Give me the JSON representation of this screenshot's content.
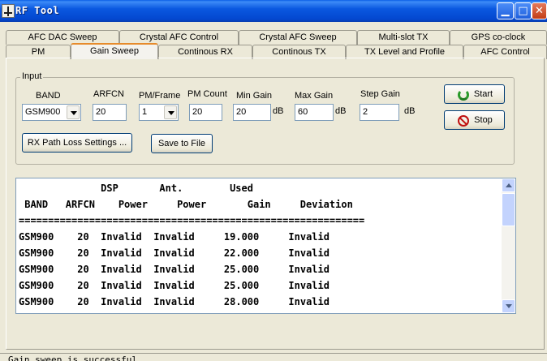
{
  "window": {
    "title": "RF Tool"
  },
  "tabs_row1": [
    {
      "label": "AFC DAC Sweep"
    },
    {
      "label": "Crystal AFC Control"
    },
    {
      "label": "Crystal AFC Sweep"
    },
    {
      "label": "Multi-slot TX"
    },
    {
      "label": "GPS co-clock"
    }
  ],
  "tabs_row2": [
    {
      "label": "PM"
    },
    {
      "label": "Gain Sweep"
    },
    {
      "label": "Continous RX"
    },
    {
      "label": "Continous TX"
    },
    {
      "label": "TX Level and Profile"
    },
    {
      "label": "AFC Control"
    }
  ],
  "active_tab": "Gain Sweep",
  "input": {
    "group_title": "Input",
    "band": {
      "label": "BAND",
      "value": "GSM900"
    },
    "arfcn": {
      "label": "ARFCN",
      "value": "20"
    },
    "pm_frame": {
      "label": "PM/Frame",
      "value": "1"
    },
    "pm_count": {
      "label": "PM Count",
      "value": "20"
    },
    "min_gain": {
      "label": "Min Gain",
      "value": "20",
      "unit": "dB"
    },
    "max_gain": {
      "label": "Max Gain",
      "value": "60",
      "unit": "dB"
    },
    "step_gain": {
      "label": "Step Gain",
      "value": "2",
      "unit": "dB"
    },
    "rx_path_button": "RX Path Loss Settings ...",
    "save_button": "Save to File",
    "start_button": "Start",
    "stop_button": "Stop"
  },
  "output": {
    "header_line1": "              DSP       Ant.        Used",
    "header_line2": " BAND   ARFCN    Power     Power       Gain     Deviation",
    "separator": "===========================================================",
    "rows": [
      {
        "band": "GSM900",
        "arfcn": "20",
        "dsp_power": "Invalid",
        "ant_power": "Invalid",
        "used_gain": "19.000",
        "deviation": "Invalid"
      },
      {
        "band": "GSM900",
        "arfcn": "20",
        "dsp_power": "Invalid",
        "ant_power": "Invalid",
        "used_gain": "22.000",
        "deviation": "Invalid"
      },
      {
        "band": "GSM900",
        "arfcn": "20",
        "dsp_power": "Invalid",
        "ant_power": "Invalid",
        "used_gain": "25.000",
        "deviation": "Invalid"
      },
      {
        "band": "GSM900",
        "arfcn": "20",
        "dsp_power": "Invalid",
        "ant_power": "Invalid",
        "used_gain": "25.000",
        "deviation": "Invalid"
      },
      {
        "band": "GSM900",
        "arfcn": "20",
        "dsp_power": "Invalid",
        "ant_power": "Invalid",
        "used_gain": "28.000",
        "deviation": "Invalid"
      }
    ]
  },
  "status": {
    "text": "Gain sweep is successful"
  }
}
